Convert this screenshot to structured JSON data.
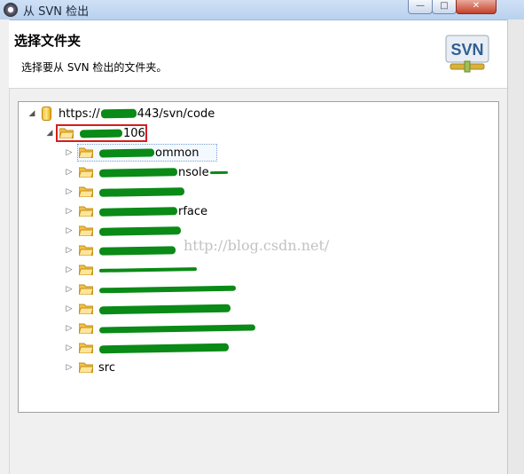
{
  "window": {
    "title": "从 SVN 检出",
    "min_label": "—",
    "max_label": "□",
    "close_label": "✕"
  },
  "header": {
    "title": "选择文件夹",
    "description": "选择要从 SVN 检出的文件夹。",
    "logo_text": "SVN"
  },
  "tree": {
    "root": {
      "url_prefix": "https://",
      "url_suffix": "443/svn/code"
    },
    "folder_suffix": "106",
    "items": [
      {
        "suffix": "ommon"
      },
      {
        "suffix": "nsole"
      },
      {
        "suffix": ""
      },
      {
        "suffix": "rface"
      },
      {
        "suffix": ""
      },
      {
        "suffix": ""
      },
      {
        "suffix": ""
      },
      {
        "suffix": ""
      },
      {
        "suffix": ""
      },
      {
        "suffix": ""
      },
      {
        "suffix": ""
      },
      {
        "suffix": "src"
      }
    ]
  },
  "watermark": "http://blog.csdn.net/",
  "colors": {
    "accent_red": "#d61d1d",
    "redaction_green": "#0a8a16",
    "folder": "#f2c04b"
  }
}
